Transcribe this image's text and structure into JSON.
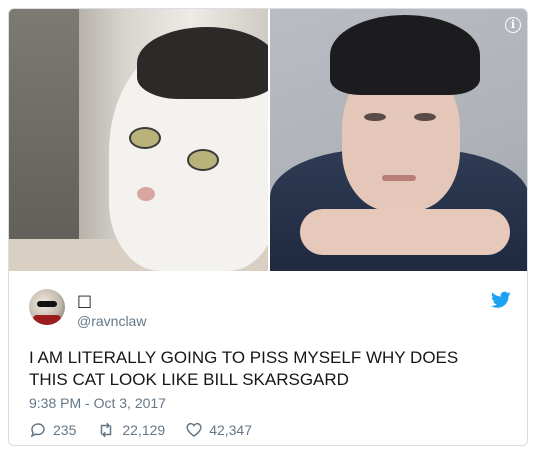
{
  "media": {
    "left_image": "cat-photo",
    "right_image": "man-photo",
    "info_icon": "info-icon"
  },
  "tweet": {
    "display_name": "□",
    "handle": "@ravnclaw",
    "text": "I AM LITERALLY GOING TO PISS MYSELF WHY DOES THIS CAT LOOK LIKE BILL SKARSGARD",
    "timestamp": "9:38 PM - Oct 3, 2017",
    "replies": "235",
    "retweets": "22,129",
    "likes": "42,347"
  },
  "colors": {
    "twitter_blue": "#1da1f2",
    "text_primary": "#14171a",
    "text_secondary": "#657786",
    "border": "#d9dee3"
  }
}
